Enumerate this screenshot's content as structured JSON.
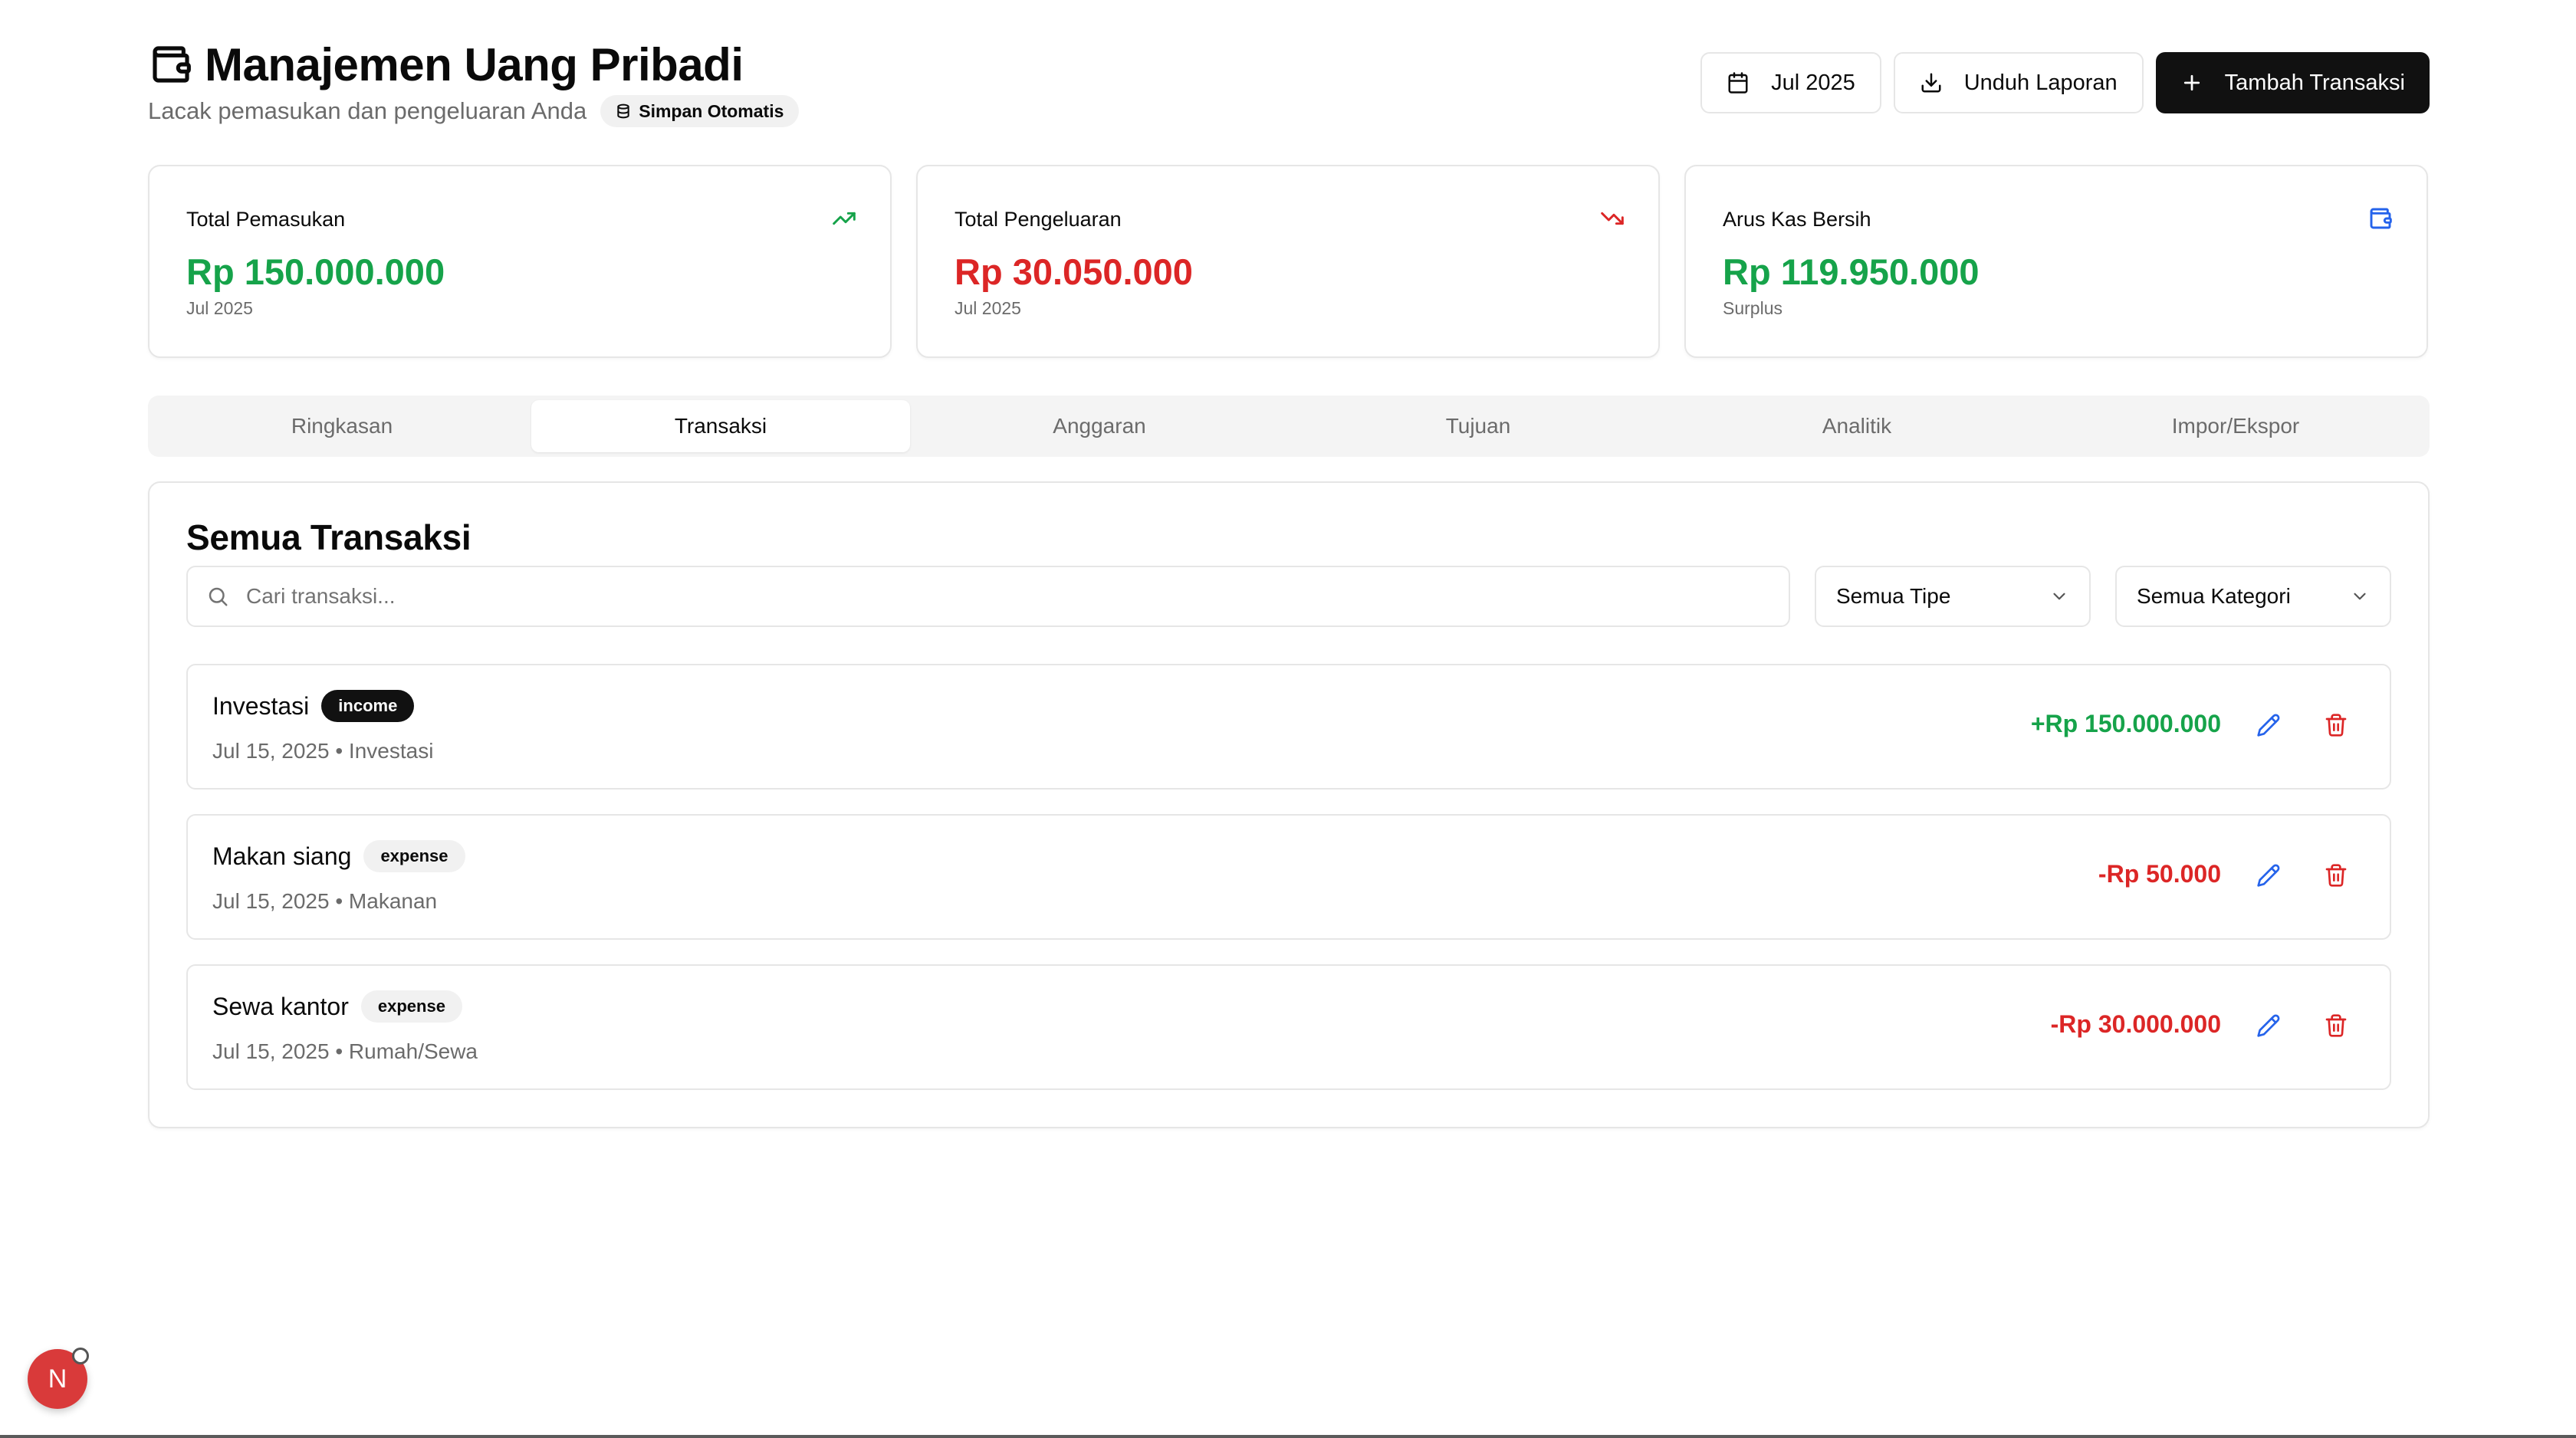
{
  "header": {
    "title": "Manajemen Uang Pribadi",
    "subtitle": "Lacak pemasukan dan pengeluaran Anda",
    "autosave_label": "Simpan Otomatis",
    "month_label": "Jul 2025",
    "download_label": "Unduh Laporan",
    "add_label": "Tambah Transaksi"
  },
  "stats": [
    {
      "label": "Total Pemasukan",
      "value": "Rp 150.000.000",
      "sub": "Jul 2025",
      "icon": "trending-up-icon",
      "color": "#16a34a"
    },
    {
      "label": "Total Pengeluaran",
      "value": "Rp 30.050.000",
      "sub": "Jul 2025",
      "icon": "trending-down-icon",
      "color": "#dc2626"
    },
    {
      "label": "Arus Kas Bersih",
      "value": "Rp 119.950.000",
      "sub": "Surplus",
      "icon": "wallet-icon",
      "color": "#16a34a"
    }
  ],
  "tabs": [
    {
      "label": "Ringkasan",
      "active": false
    },
    {
      "label": "Transaksi",
      "active": true
    },
    {
      "label": "Anggaran",
      "active": false
    },
    {
      "label": "Tujuan",
      "active": false
    },
    {
      "label": "Analitik",
      "active": false
    },
    {
      "label": "Impor/Ekspor",
      "active": false
    }
  ],
  "transactions_panel": {
    "title": "Semua Transaksi",
    "search_placeholder": "Cari transaksi...",
    "type_filter": "Semua Tipe",
    "category_filter": "Semua Kategori"
  },
  "transactions": [
    {
      "name": "Investasi",
      "type": "income",
      "meta": "Jul 15, 2025 • Investasi",
      "amount": "+Rp 150.000.000"
    },
    {
      "name": "Makan siang",
      "type": "expense",
      "meta": "Jul 15, 2025 • Makanan",
      "amount": "-Rp 50.000"
    },
    {
      "name": "Sewa kantor",
      "type": "expense",
      "meta": "Jul 15, 2025 • Rumah/Sewa",
      "amount": "-Rp 30.000.000"
    }
  ],
  "colors": {
    "income": "#16a34a",
    "expense": "#dc2626",
    "edit": "#2563eb",
    "primary_button": "#111111"
  },
  "fab_letter": "N"
}
